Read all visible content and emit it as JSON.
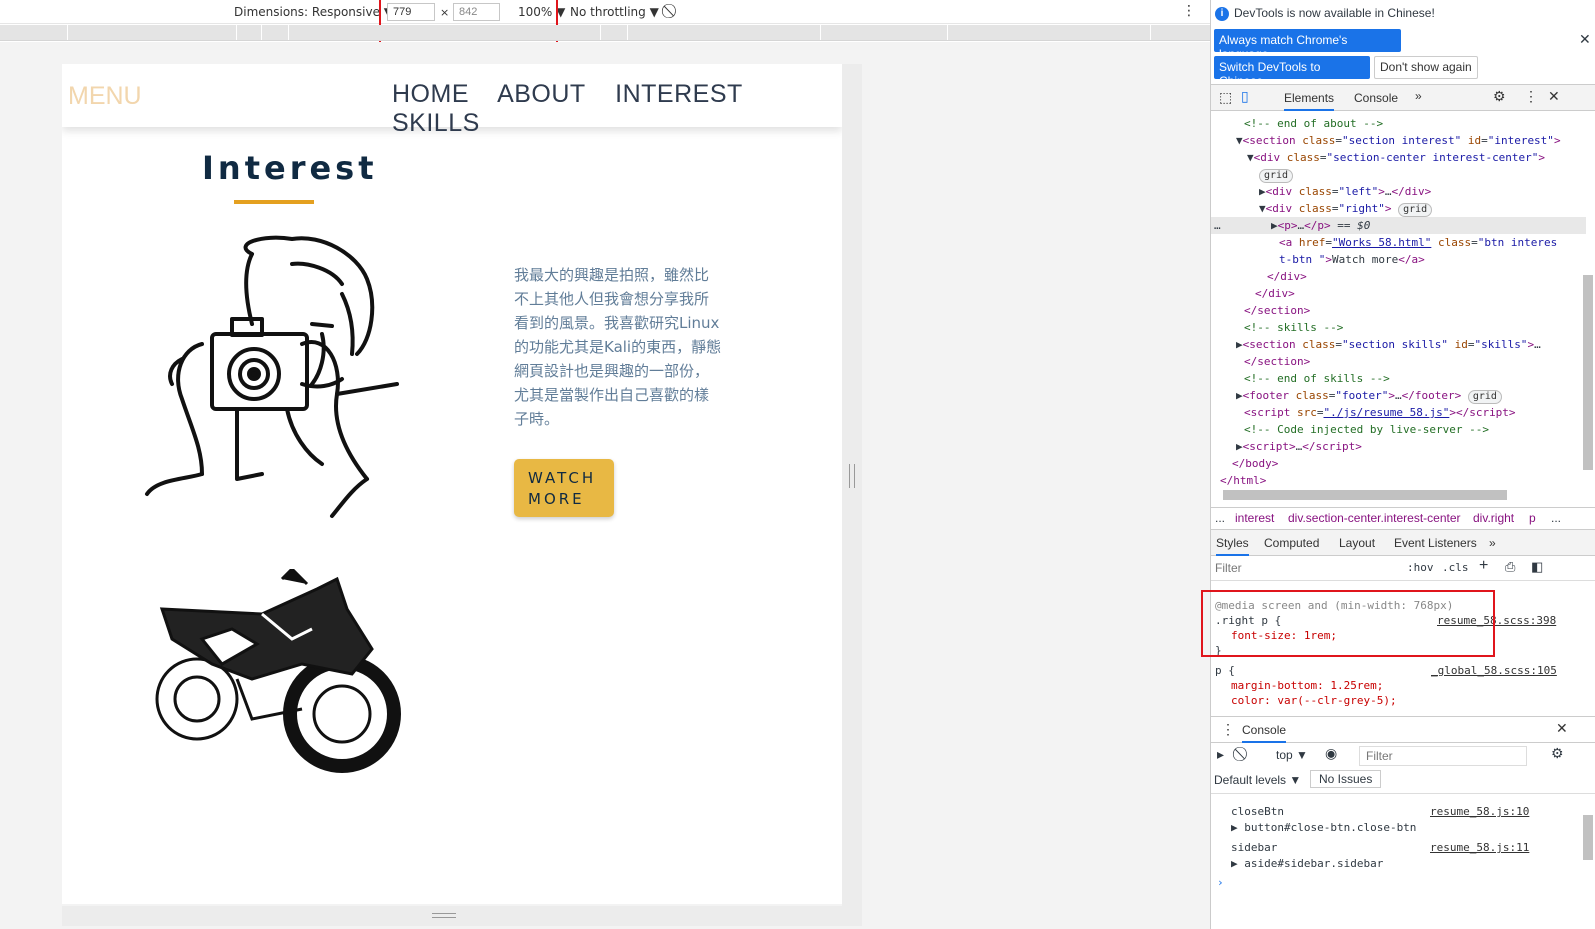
{
  "toolbar": {
    "dimensions_label": "Dimensions: Responsive ▼",
    "width": "779",
    "times": "×",
    "height": "842",
    "zoom": "100% ▼",
    "throttling": "No throttling ▼"
  },
  "page": {
    "menu": "MENU",
    "nav": [
      "HOME",
      "ABOUT",
      "INTEREST",
      "SKILLS"
    ],
    "title": "Interest",
    "paragraph_lines": [
      "我最大的興趣是拍照，雖然比",
      "不上其他人但我會想分享我所",
      "看到的風景。我喜歡研究Linux",
      "的功能尤其是Kali的東西，靜態",
      "網頁設計也是興趣的一部份，",
      "尤其是當製作出自己喜歡的樣",
      "子時。"
    ],
    "button_lines": [
      "WATCH",
      "MORE"
    ]
  },
  "devtools": {
    "notice": "DevTools is now available in Chinese!",
    "btn_match": "Always match Chrome's language",
    "btn_switch": "Switch DevTools to Chinese",
    "btn_dont": "Don't show again",
    "tabs": [
      "Elements",
      "Console"
    ],
    "crumbs": [
      "...",
      "interest",
      "div.section-center.interest-center",
      "div.right",
      "p",
      "..."
    ],
    "styles_tabs": [
      "Styles",
      "Computed",
      "Layout",
      "Event Listeners"
    ],
    "filter_placeholder": "Filter",
    "hov": ":hov",
    "cls": ".cls",
    "media": "@media screen and (min-width: 768px)",
    "right_p": ".right p {",
    "right_src": "resume_58.scss:398",
    "font_size": "font-size: 1rem;",
    "p_sel": "p {",
    "p_src": "_global_58.scss:105",
    "margin_bottom": "margin-bottom: 1.25rem;",
    "color_line": "color: var(--clr-grey-5);",
    "console_tab": "Console",
    "top": "top ▼",
    "default_levels": "Default levels ▼",
    "no_issues": "No Issues",
    "console_rows": [
      {
        "name": "closeBtn",
        "src": "resume_58.js:10",
        "detail": "▶ button#close-btn.close-btn"
      },
      {
        "name": "sidebar",
        "src": "resume_58.js:11",
        "detail": "▶ aside#sidebar.sidebar"
      }
    ]
  }
}
